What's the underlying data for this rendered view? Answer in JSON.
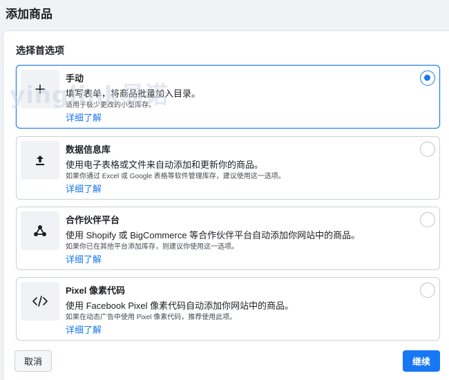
{
  "page": {
    "title": "添加商品"
  },
  "section": {
    "title": "选择首选项"
  },
  "watermark": "yinglink易诺",
  "options": [
    {
      "icon": "plus-icon",
      "title": "手动",
      "description": "填写表单，将商品批量加入目录。",
      "note": "适用于极少更改的小型库存。",
      "link": "详细了解",
      "selected": true
    },
    {
      "icon": "upload-icon",
      "title": "数据信息库",
      "description": "使用电子表格或文件来自动添加和更新你的商品。",
      "note": "如果你通过 Excel 或 Google 表格等软件管理库存，建议使用这一选项。",
      "link": "详细了解",
      "selected": false
    },
    {
      "icon": "share-nodes-icon",
      "title": "合作伙伴平台",
      "description": "使用 Shopify 或 BigCommerce 等合作伙伴平台自动添加你网站中的商品。",
      "note": "如果你已在其他平台添加库存，则建议你使用这一选项。",
      "link": "详细了解",
      "selected": false
    },
    {
      "icon": "code-icon",
      "title": "Pixel 像素代码",
      "description": "使用 Facebook Pixel 像素代码自动添加你网站中的商品。",
      "note": "如果在动态广告中使用 Pixel 像素代码，推荐使用此项。",
      "link": "详细了解",
      "selected": false
    }
  ],
  "footer": {
    "cancel_label": "取消",
    "continue_label": "继续"
  },
  "colors": {
    "accent": "#1877f2",
    "border": "#ccd0d5",
    "background": "#f0f2f5"
  }
}
